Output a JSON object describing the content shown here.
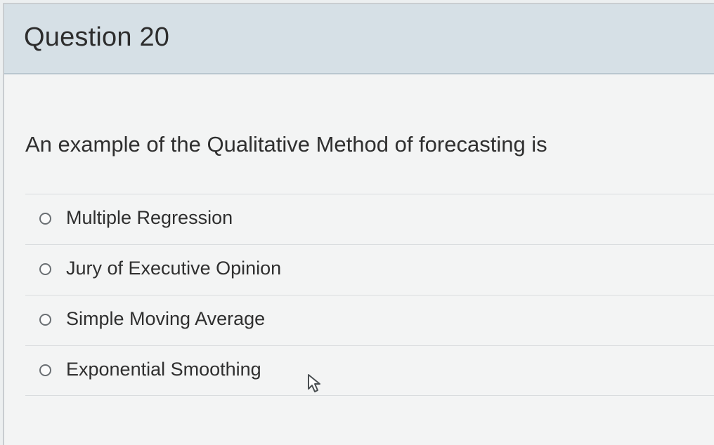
{
  "question": {
    "title": "Question 20",
    "text": "An example of the Qualitative Method of forecasting is"
  },
  "answers": [
    {
      "label": "Multiple Regression",
      "selected": false
    },
    {
      "label": "Jury of Executive Opinion",
      "selected": false
    },
    {
      "label": "Simple Moving Average",
      "selected": false
    },
    {
      "label": "Exponential Smoothing",
      "selected": false
    }
  ],
  "icons": {
    "radio": "radio-button-icon",
    "cursor": "mouse-pointer-icon"
  }
}
